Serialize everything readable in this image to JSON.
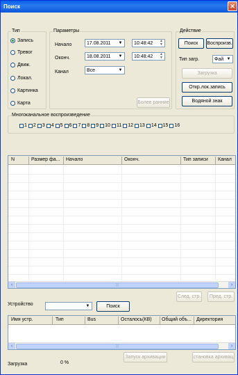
{
  "window": {
    "title": "Поиск"
  },
  "type_group": {
    "legend": "Тип",
    "options": [
      {
        "label": "Запись",
        "selected": true
      },
      {
        "label": "Тревог",
        "selected": false
      },
      {
        "label": "Движ.",
        "selected": false
      },
      {
        "label": "Локал.",
        "selected": false
      },
      {
        "label": "Картинка",
        "selected": false
      },
      {
        "label": "Карта",
        "selected": false
      }
    ]
  },
  "params": {
    "legend": "Параметры",
    "start_label": "Начало",
    "start_date": "17.08.2011",
    "start_time": "10:48:42",
    "end_label": "Оконч.",
    "end_date": "18.08.2011",
    "end_time": "10:48:42",
    "channel_label": "Канал",
    "channel_value": "Все",
    "earlier_button": "Более ранние"
  },
  "action": {
    "legend": "Действие",
    "search_button": "Поиск",
    "play_button": "Воспроизв.",
    "load_type_label": "Тип загр.",
    "load_type_value": "Фай",
    "download_button": "Загрузка",
    "open_local_button": "Откр.лок.запись",
    "watermark_button": "Водяной знак"
  },
  "multichannel": {
    "legend": "Многоканальное воспроизведение",
    "channels": [
      "1",
      "2",
      "3",
      "4",
      "5",
      "6",
      "7",
      "8",
      "9",
      "10",
      "11",
      "12",
      "13",
      "14",
      "15",
      "16"
    ]
  },
  "results_table": {
    "columns": [
      "N",
      "Размер фа...",
      "Начало",
      "Оконч.",
      "Тип записи",
      "Канал"
    ]
  },
  "paging": {
    "next_button": "След. стр.",
    "prev_button": "Пред. стр."
  },
  "device": {
    "label": "Устройство",
    "value": "",
    "search_button": "Поиск"
  },
  "device_table": {
    "columns": [
      "Имя устр.",
      "Тип",
      "Bus",
      "Осталось(КВ)",
      "Общий объ...",
      "Директория"
    ]
  },
  "archive": {
    "start_button": "Запуск архивации",
    "stop_button": "становка архивац"
  },
  "status": {
    "label": "Загрузка",
    "value": "0 %"
  }
}
